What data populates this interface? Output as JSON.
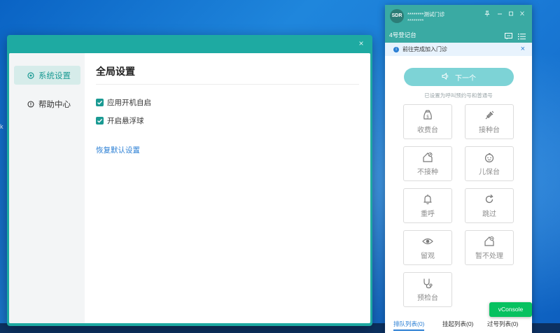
{
  "settings": {
    "nav": [
      {
        "label": "系统设置",
        "icon": "settings-icon"
      },
      {
        "label": "帮助中心",
        "icon": "help-icon"
      }
    ],
    "title": "全局设置",
    "options": [
      {
        "label": "应用开机自启",
        "checked": true
      },
      {
        "label": "开启悬浮球",
        "checked": true
      }
    ],
    "restore_label": "恢复默认设置",
    "close_label": "×"
  },
  "reg": {
    "logo_text": "SDR",
    "clinic_name": "********测试门诊",
    "clinic_sub": "********",
    "station": "4号登记台",
    "notice": "前往完成加入门诊",
    "notice_close": "×",
    "next_label": "下一个",
    "hint": "已设置为呼叫预约号和普通号",
    "buttons": [
      {
        "label": "收费台",
        "icon": "money-bag-icon"
      },
      {
        "label": "接种台",
        "icon": "syringe-icon"
      },
      {
        "label": "不接种",
        "icon": "house-cancel-icon"
      },
      {
        "label": "儿保台",
        "icon": "baby-face-icon"
      },
      {
        "label": "重呼",
        "icon": "bell-icon"
      },
      {
        "label": "跳过",
        "icon": "redo-icon"
      },
      {
        "label": "留观",
        "icon": "eye-icon"
      },
      {
        "label": "暂不处理",
        "icon": "house-pause-icon"
      },
      {
        "label": "预检台",
        "icon": "stethoscope-icon"
      }
    ],
    "tabs": [
      {
        "label": "排队列表(0)"
      },
      {
        "label": "挂起列表(0)"
      },
      {
        "label": "过号列表(0)"
      }
    ]
  },
  "vconsole_label": "vConsole",
  "colors": {
    "teal": "#1eaaa2",
    "teal_header": "#3aaaa3",
    "next_button": "#7dd3d6",
    "link_blue": "#2b7fd4",
    "vconsole_green": "#07c160"
  }
}
